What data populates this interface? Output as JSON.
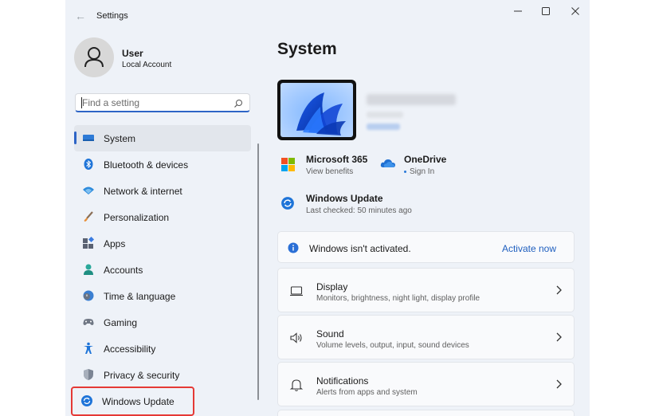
{
  "window": {
    "title": "Settings"
  },
  "account": {
    "name": "User",
    "type": "Local Account"
  },
  "search": {
    "placeholder": "Find a setting"
  },
  "nav": {
    "items": [
      {
        "label": "System",
        "icon": "display-icon"
      },
      {
        "label": "Bluetooth & devices",
        "icon": "bluetooth-icon"
      },
      {
        "label": "Network & internet",
        "icon": "wifi-icon"
      },
      {
        "label": "Personalization",
        "icon": "brush-icon"
      },
      {
        "label": "Apps",
        "icon": "apps-icon"
      },
      {
        "label": "Accounts",
        "icon": "person-icon"
      },
      {
        "label": "Time & language",
        "icon": "clock-globe-icon"
      },
      {
        "label": "Gaming",
        "icon": "gamepad-icon"
      },
      {
        "label": "Accessibility",
        "icon": "accessibility-icon"
      },
      {
        "label": "Privacy & security",
        "icon": "shield-icon"
      },
      {
        "label": "Windows Update",
        "icon": "update-icon"
      }
    ],
    "active_index": 0,
    "highlighted_index": 10
  },
  "page": {
    "title": "System"
  },
  "tiles": {
    "microsoft365": {
      "title": "Microsoft 365",
      "subtitle": "View benefits"
    },
    "onedrive": {
      "title": "OneDrive",
      "subtitle": "Sign In"
    },
    "windows_update": {
      "title": "Windows Update",
      "subtitle": "Last checked: 50 minutes ago"
    }
  },
  "activation": {
    "message": "Windows isn't activated.",
    "action": "Activate now"
  },
  "cards": [
    {
      "title": "Display",
      "subtitle": "Monitors, brightness, night light, display profile"
    },
    {
      "title": "Sound",
      "subtitle": "Volume levels, output, input, sound devices"
    },
    {
      "title": "Notifications",
      "subtitle": "Alerts from apps and system"
    }
  ],
  "colors": {
    "accent": "#2d64c6",
    "highlight_box": "#e53935",
    "window_bg": "#eef2f8"
  }
}
